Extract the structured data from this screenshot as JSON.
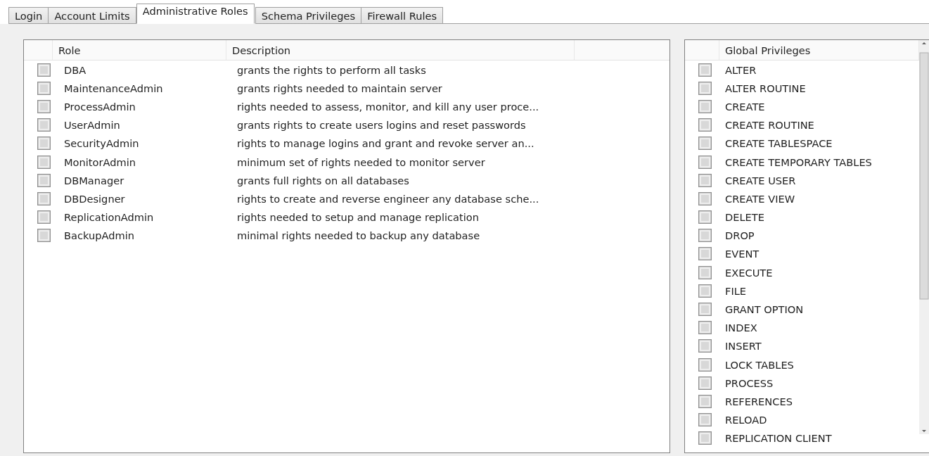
{
  "tabs": [
    {
      "label": "Login",
      "selected": false
    },
    {
      "label": "Account Limits",
      "selected": false
    },
    {
      "label": "Administrative Roles",
      "selected": true
    },
    {
      "label": "Schema Privileges",
      "selected": false
    },
    {
      "label": "Firewall Rules",
      "selected": false
    }
  ],
  "roles_table": {
    "columns": [
      "Role",
      "Description"
    ],
    "rows": [
      {
        "role": "DBA",
        "description": "grants the rights to perform all tasks",
        "checked": false
      },
      {
        "role": "MaintenanceAdmin",
        "description": "grants rights needed to maintain server",
        "checked": false
      },
      {
        "role": "ProcessAdmin",
        "description": "rights needed to assess, monitor, and kill any user proce...",
        "checked": false
      },
      {
        "role": "UserAdmin",
        "description": "grants rights to create users logins and reset passwords",
        "checked": false
      },
      {
        "role": "SecurityAdmin",
        "description": "rights to manage logins and grant and revoke server an...",
        "checked": false
      },
      {
        "role": "MonitorAdmin",
        "description": "minimum set of rights needed to monitor server",
        "checked": false
      },
      {
        "role": "DBManager",
        "description": "grants full rights on all databases",
        "checked": false
      },
      {
        "role": "DBDesigner",
        "description": "rights to create and reverse engineer any database sche...",
        "checked": false
      },
      {
        "role": "ReplicationAdmin",
        "description": "rights needed to setup and manage replication",
        "checked": false
      },
      {
        "role": "BackupAdmin",
        "description": "minimal rights needed to backup any database",
        "checked": false
      }
    ]
  },
  "privileges_table": {
    "column": "Global Privileges",
    "rows": [
      {
        "name": "ALTER",
        "checked": false
      },
      {
        "name": "ALTER ROUTINE",
        "checked": false
      },
      {
        "name": "CREATE",
        "checked": false
      },
      {
        "name": "CREATE ROUTINE",
        "checked": false
      },
      {
        "name": "CREATE TABLESPACE",
        "checked": false
      },
      {
        "name": "CREATE TEMPORARY TABLES",
        "checked": false
      },
      {
        "name": "CREATE USER",
        "checked": false
      },
      {
        "name": "CREATE VIEW",
        "checked": false
      },
      {
        "name": "DELETE",
        "checked": false
      },
      {
        "name": "DROP",
        "checked": false
      },
      {
        "name": "EVENT",
        "checked": false
      },
      {
        "name": "EXECUTE",
        "checked": false
      },
      {
        "name": "FILE",
        "checked": false
      },
      {
        "name": "GRANT OPTION",
        "checked": false
      },
      {
        "name": "INDEX",
        "checked": false
      },
      {
        "name": "INSERT",
        "checked": false
      },
      {
        "name": "LOCK TABLES",
        "checked": false
      },
      {
        "name": "PROCESS",
        "checked": false
      },
      {
        "name": "REFERENCES",
        "checked": false
      },
      {
        "name": "RELOAD",
        "checked": false
      },
      {
        "name": "REPLICATION CLIENT",
        "checked": false
      }
    ]
  }
}
